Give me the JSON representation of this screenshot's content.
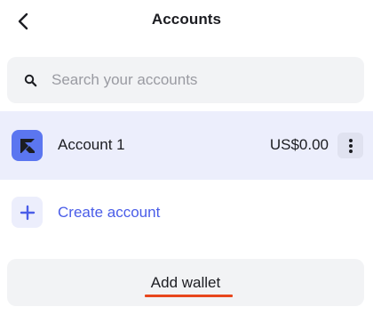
{
  "header": {
    "title": "Accounts",
    "back_icon": "chevron-left-icon"
  },
  "search": {
    "placeholder": "Search your accounts",
    "value": "",
    "icon": "search-icon"
  },
  "accounts": [
    {
      "name": "Account 1",
      "balance": "US$0.00",
      "selected": true,
      "logo_icon": "account-logo-icon",
      "menu_icon": "more-vertical-icon"
    }
  ],
  "create_account": {
    "label": "Create account",
    "icon": "plus-icon"
  },
  "add_wallet": {
    "label": "Add wallet"
  },
  "colors": {
    "accent": "#4a5de8",
    "selected_row": "#eceefc",
    "logo": "#5b76f0",
    "underline": "#e8471d",
    "surface": "#f2f3f5"
  }
}
